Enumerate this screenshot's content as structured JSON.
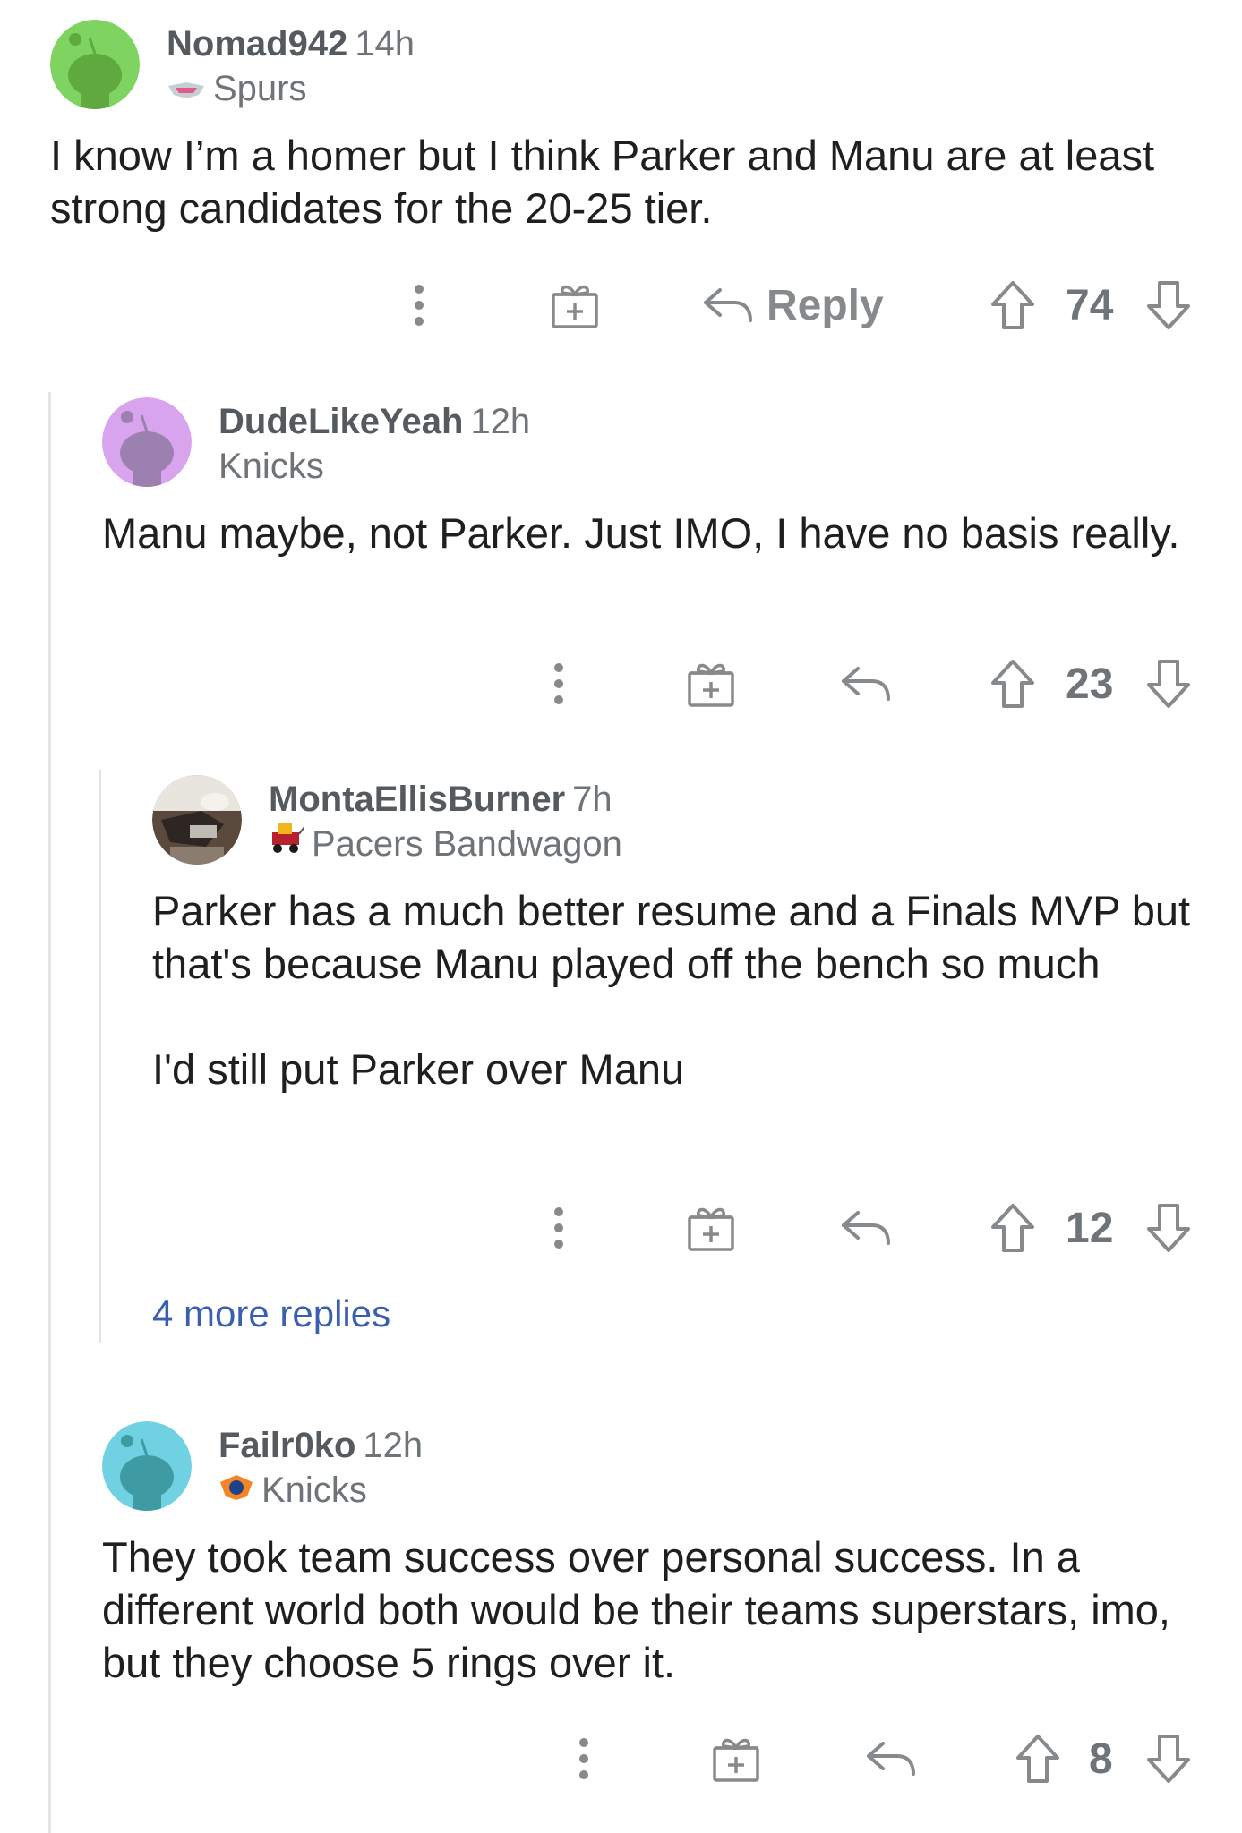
{
  "comments": [
    {
      "username": "Nomad942",
      "time": "14h",
      "flair": "Spurs",
      "flair_icon": "spurs-logo-icon",
      "avatar_color": "#7ed361",
      "body": [
        "I know I’m a homer but I think Parker and Manu are at least strong candidates for the 20-25 tier."
      ],
      "reply_label": "Reply",
      "score": "74"
    },
    {
      "username": "DudeLikeYeah",
      "time": "12h",
      "flair": "Knicks",
      "avatar_color": "#d9a4ee",
      "body": [
        "Manu maybe, not Parker. Just IMO, I have no basis really."
      ],
      "score": "23"
    },
    {
      "username": "MontaEllisBurner",
      "time": "7h",
      "flair": "Pacers Bandwagon",
      "flair_icon": "bandwagon-icon",
      "avatar_color": "#5a4a3d",
      "body": [
        "Parker has a much better resume and a Finals MVP but that's because Manu played off the bench so much",
        "I'd still put Parker over Manu"
      ],
      "score": "12"
    },
    {
      "username": "Failr0ko",
      "time": "12h",
      "flair": "Knicks",
      "flair_icon": "knicks-logo-icon",
      "avatar_color": "#6fd1e2",
      "body": [
        "They took team success over personal success. In a different world both would be their teams superstars, imo, but they choose 5 rings over it."
      ],
      "score": "8"
    }
  ],
  "more_replies": "4 more replies",
  "colors": {
    "accent_link": "#3b5fb0",
    "icon_gray": "#878a8c",
    "thread_line": "#e3e3e3"
  }
}
